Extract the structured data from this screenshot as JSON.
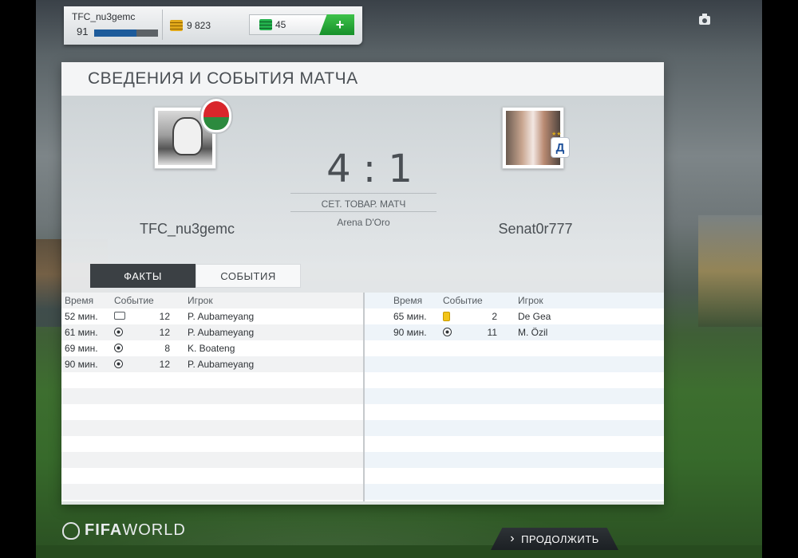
{
  "topbar": {
    "username": "TFC_nu3gemc",
    "level": "91",
    "xp_progress": 0.66,
    "coins": "9 823",
    "points": "45",
    "plus_label": "+"
  },
  "panel": {
    "title": "СВЕДЕНИЯ И СОБЫТИЯ МАТЧА"
  },
  "match": {
    "score": "4 : 1",
    "type": "СЕТ. ТОВАР. МАТЧ",
    "stadium": "Arena D'Oro",
    "home_team": "TFC_nu3gemc",
    "away_team": "Senat0r777",
    "home_badge_icon": "wales-dragon-badge-icon",
    "away_badge_icon": "dynamo-badge-icon"
  },
  "tabs": [
    {
      "label": "ФАКТЫ",
      "active": true
    },
    {
      "label": "СОБЫТИЯ",
      "active": false
    }
  ],
  "events_header": {
    "time": "Время",
    "event": "Событие",
    "player": "Игрок"
  },
  "home_events": [
    {
      "time": "52 мин.",
      "icon": "substitution-icon",
      "number": "12",
      "player": "P. Aubameyang"
    },
    {
      "time": "61 мин.",
      "icon": "goal-ball-icon",
      "number": "12",
      "player": "P. Aubameyang"
    },
    {
      "time": "69 мин.",
      "icon": "goal-ball-icon",
      "number": "8",
      "player": "K. Boateng"
    },
    {
      "time": "90 мин.",
      "icon": "goal-ball-icon",
      "number": "12",
      "player": "P. Aubameyang"
    }
  ],
  "away_events": [
    {
      "time": "65 мин.",
      "icon": "yellow-card-icon",
      "number": "2",
      "player": "De Gea"
    },
    {
      "time": "90 мин.",
      "icon": "goal-ball-icon",
      "number": "11",
      "player": "M. Özil"
    }
  ],
  "footer": {
    "logo_bold": "FIFA",
    "logo_light": "WORLD",
    "continue_label": "ПРОДОЛЖИТЬ",
    "continue_arrow": "›"
  },
  "colors": {
    "tab_active": "#3b4044",
    "goal_green": "#23b14d",
    "yellow_card": "#f2c418"
  }
}
